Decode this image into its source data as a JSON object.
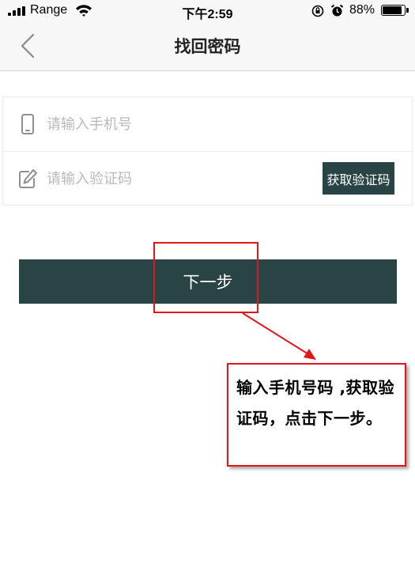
{
  "status_bar": {
    "carrier": "Range",
    "time": "下午2:59",
    "battery_percent_text": "88%",
    "battery_level": 0.88,
    "icons": [
      "signal-icon",
      "wifi-icon",
      "orientation-lock-icon",
      "alarm-icon",
      "battery-icon"
    ]
  },
  "nav": {
    "title": "找回密码",
    "back_icon": "chevron-left-icon"
  },
  "form": {
    "phone": {
      "icon": "phone-icon",
      "placeholder": "请输入手机号",
      "value": ""
    },
    "code": {
      "icon": "edit-icon",
      "placeholder": "请输入验证码",
      "value": "",
      "get_code_label": "获取验证码"
    }
  },
  "next_button": {
    "label": "下一步"
  },
  "annotation": {
    "callout_text": "输入手机号码 ,获取验证码，点击下一步。",
    "color": "#e3161a"
  },
  "colors": {
    "primary_button": "#284444",
    "placeholder": "#b9b9b9",
    "nav_background": "#f7f7f7"
  }
}
